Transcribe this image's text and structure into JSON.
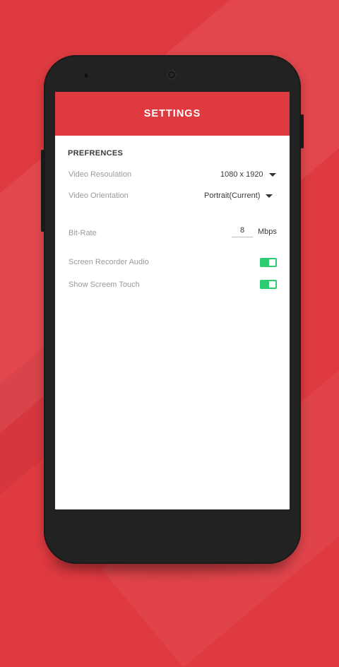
{
  "app_bar": {
    "title": "SETTINGS"
  },
  "preferences": {
    "section_title": "PREFRENCES",
    "video_resolution": {
      "label": "Video Resoulation",
      "value": "1080 x 1920"
    },
    "video_orientation": {
      "label": "Video Orientation",
      "value": "Portrait(Current)"
    },
    "bit_rate": {
      "label": "Bit-Rate",
      "value": "8",
      "unit": "Mbps"
    },
    "screen_recorder_audio": {
      "label": "Screen Recorder Audio",
      "enabled": true
    },
    "show_screen_touch": {
      "label": "Show Screem Touch",
      "enabled": true
    }
  },
  "colors": {
    "accent": "#de3a40",
    "background": "#df3a40",
    "toggle_on": "#2ecc71",
    "phone_body": "#222222"
  },
  "icons": {
    "dropdown": "dropdown-arrow-icon",
    "toggle": "toggle-switch-icon"
  }
}
